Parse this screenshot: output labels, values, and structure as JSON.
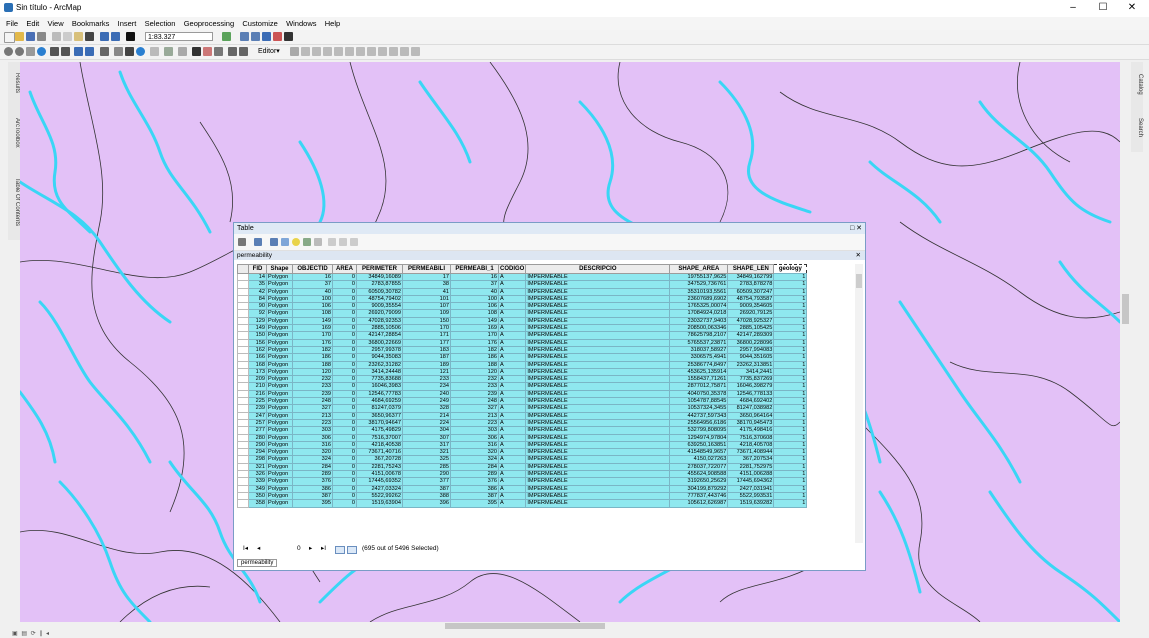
{
  "window": {
    "title": "Sin título - ArcMap",
    "minimize": "–",
    "maximize": "☐",
    "close": "✕"
  },
  "menu": [
    "File",
    "Edit",
    "View",
    "Bookmarks",
    "Insert",
    "Selection",
    "Geoprocessing",
    "Customize",
    "Windows",
    "Help"
  ],
  "toolbar": {
    "scale": "1:83.327",
    "editor_label": "Editor▾"
  },
  "left_dock": [
    "Results",
    "ArcToolbox",
    "Table Of Contents"
  ],
  "right_dock": [
    "Catalog",
    "Search"
  ],
  "colors": {
    "map_fill": "#e3c1f7",
    "river": "#3ad6f5",
    "boundary": "#333333",
    "selected_row": "#8fe8ef"
  },
  "table_window": {
    "title": "Table",
    "controls": "□ ✕",
    "layer_name": "permeability",
    "close_tab": "✕",
    "columns": [
      "FID",
      "Shape",
      "OBJECTID",
      "AREA",
      "PERIMETER",
      "PERMEABILI",
      "PERMEABI_1",
      "CODIGO",
      "DESCRIPCIO",
      "SHAPE_AREA",
      "SHAPE_LEN",
      "geology"
    ],
    "rows": [
      [
        "14",
        "Polygon",
        "16",
        "0",
        "34849,16089",
        "17",
        "16",
        "A",
        "IMPERMEABLE",
        "19755137,9625",
        "34849,162799",
        "1"
      ],
      [
        "35",
        "Polygon",
        "37",
        "0",
        "2783,87855",
        "38",
        "37",
        "A",
        "IMPERMEABLE",
        "347529,736761",
        "2783,878278",
        "1"
      ],
      [
        "42",
        "Polygon",
        "40",
        "0",
        "60509,30782",
        "41",
        "40",
        "A",
        "IMPERMEABLE",
        "35310193,5561",
        "60509,307247",
        "1"
      ],
      [
        "84",
        "Polygon",
        "100",
        "0",
        "48754,79402",
        "101",
        "100",
        "A",
        "IMPERMEABLE",
        "23607689,6902",
        "48754,793587",
        "1"
      ],
      [
        "90",
        "Polygon",
        "106",
        "0",
        "9009,35554",
        "107",
        "106",
        "A",
        "IMPERMEABLE",
        "1765325,00074",
        "9009,354605",
        "1"
      ],
      [
        "92",
        "Polygon",
        "108",
        "0",
        "26920,79099",
        "109",
        "108",
        "A",
        "IMPERMEABLE",
        "17084924,0218",
        "26920,79125",
        "1"
      ],
      [
        "129",
        "Polygon",
        "149",
        "0",
        "47028,92353",
        "150",
        "149",
        "A",
        "IMPERMEABLE",
        "23032737,9403",
        "47028,925327",
        "1"
      ],
      [
        "149",
        "Polygon",
        "169",
        "0",
        "2885,10506",
        "170",
        "169",
        "A",
        "IMPERMEABLE",
        "208500,063346",
        "2885,105425",
        "1"
      ],
      [
        "150",
        "Polygon",
        "170",
        "0",
        "42147,28854",
        "171",
        "170",
        "A",
        "IMPERMEABLE",
        "78625798,2107",
        "42147,289309",
        "1"
      ],
      [
        "156",
        "Polygon",
        "176",
        "0",
        "36800,22669",
        "177",
        "176",
        "A",
        "IMPERMEABLE",
        "5765537,23871",
        "36800,228096",
        "1"
      ],
      [
        "162",
        "Polygon",
        "182",
        "0",
        "2957,99378",
        "183",
        "182",
        "A",
        "IMPERMEABLE",
        "318037,58927",
        "2957,994083",
        "1"
      ],
      [
        "166",
        "Polygon",
        "186",
        "0",
        "9044,35083",
        "187",
        "186",
        "A",
        "IMPERMEABLE",
        "3306575,4941",
        "9044,351605",
        "1"
      ],
      [
        "168",
        "Polygon",
        "188",
        "0",
        "23262,31282",
        "189",
        "188",
        "A",
        "IMPERMEABLE",
        "25386774,8497",
        "23262,313851",
        "1"
      ],
      [
        "173",
        "Polygon",
        "120",
        "0",
        "3414,24448",
        "121",
        "120",
        "A",
        "IMPERMEABLE",
        "453625,135914",
        "3414,2441",
        "1"
      ],
      [
        "209",
        "Polygon",
        "232",
        "0",
        "7735,83688",
        "233",
        "232",
        "A",
        "IMPERMEABLE",
        "1558437,71261",
        "7735,837269",
        "1"
      ],
      [
        "210",
        "Polygon",
        "233",
        "0",
        "16046,3983",
        "234",
        "233",
        "A",
        "IMPERMEABLE",
        "2877012,75871",
        "16046,398279",
        "1"
      ],
      [
        "216",
        "Polygon",
        "239",
        "0",
        "12546,77783",
        "240",
        "239",
        "A",
        "IMPERMEABLE",
        "4040750,35378",
        "12546,778133",
        "1"
      ],
      [
        "225",
        "Polygon",
        "248",
        "0",
        "4684,69259",
        "249",
        "248",
        "A",
        "IMPERMEABLE",
        "1054787,88545",
        "4684,692402",
        "1"
      ],
      [
        "239",
        "Polygon",
        "327",
        "0",
        "81247,0379",
        "328",
        "327",
        "A",
        "IMPERMEABLE",
        "10537324,3455",
        "81247,038982",
        "1"
      ],
      [
        "247",
        "Polygon",
        "213",
        "0",
        "3650,96377",
        "214",
        "213",
        "A",
        "IMPERMEABLE",
        "442737,597343",
        "3650,964164",
        "1"
      ],
      [
        "257",
        "Polygon",
        "223",
        "0",
        "38170,94647",
        "224",
        "223",
        "A",
        "IMPERMEABLE",
        "25564956,6186",
        "38170,945473",
        "1"
      ],
      [
        "277",
        "Polygon",
        "303",
        "0",
        "4175,49829",
        "304",
        "303",
        "A",
        "IMPERMEABLE",
        "532799,808095",
        "4175,498416",
        "1"
      ],
      [
        "280",
        "Polygon",
        "306",
        "0",
        "7516,37007",
        "307",
        "306",
        "A",
        "IMPERMEABLE",
        "1294974,97804",
        "7516,370608",
        "1"
      ],
      [
        "290",
        "Polygon",
        "316",
        "0",
        "4218,40538",
        "317",
        "316",
        "A",
        "IMPERMEABLE",
        "639250,163851",
        "4218,405708",
        "1"
      ],
      [
        "294",
        "Polygon",
        "320",
        "0",
        "73671,40716",
        "321",
        "320",
        "A",
        "IMPERMEABLE",
        "41548549,9657",
        "73671,408944",
        "1"
      ],
      [
        "298",
        "Polygon",
        "324",
        "0",
        "367,20728",
        "325",
        "324",
        "A",
        "IMPERMEABLE",
        "4150,027263",
        "367,207534",
        "1"
      ],
      [
        "321",
        "Polygon",
        "284",
        "0",
        "2281,75243",
        "285",
        "284",
        "A",
        "IMPERMEABLE",
        "278037,722077",
        "2281,752975",
        "1"
      ],
      [
        "326",
        "Polygon",
        "289",
        "0",
        "4151,00678",
        "290",
        "289",
        "A",
        "IMPERMEABLE",
        "455624,908588",
        "4151,006288",
        "1"
      ],
      [
        "339",
        "Polygon",
        "376",
        "0",
        "17445,69352",
        "377",
        "376",
        "A",
        "IMPERMEABLE",
        "3192650,25629",
        "17445,694362",
        "1"
      ],
      [
        "349",
        "Polygon",
        "386",
        "0",
        "2427,03324",
        "387",
        "386",
        "A",
        "IMPERMEABLE",
        "304199,879292",
        "2427,031941",
        "1"
      ],
      [
        "350",
        "Polygon",
        "387",
        "0",
        "5522,99262",
        "388",
        "387",
        "A",
        "IMPERMEABLE",
        "777837,443746",
        "5522,993531",
        "1"
      ],
      [
        "358",
        "Polygon",
        "395",
        "0",
        "1519,63904",
        "396",
        "395",
        "A",
        "IMPERMEABLE",
        "105612,626987",
        "1519,639282",
        "1"
      ]
    ],
    "nav": {
      "first": "I◂",
      "prev": "◂",
      "record": "0",
      "next": "▸",
      "last": "▸I",
      "selection": "(695 out of 5496 Selected)"
    },
    "tab_label": "permeability"
  }
}
